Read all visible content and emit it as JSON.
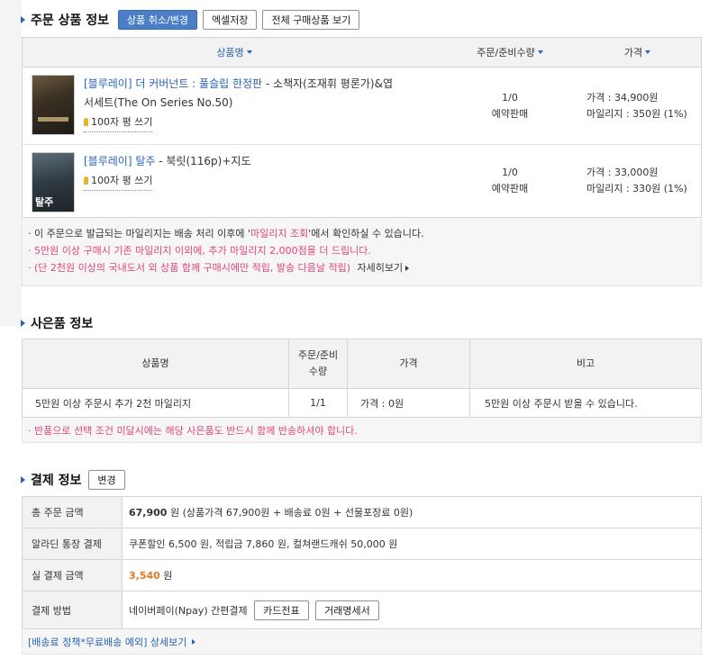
{
  "order": {
    "title": "주문 상품 정보",
    "buttons": {
      "cancel": "상품 취소/변경",
      "excel": "엑셀저장",
      "all": "전체 구매상품 보기"
    },
    "headers": {
      "name": "상품명",
      "qty": "주문/준비수량",
      "price": "가격"
    },
    "items": [
      {
        "link": "[블루레이] 더 커버넌트 : 풀슬립 한정판",
        "rest1": " - 소책자(조재휘 평론가)&엽",
        "rest2": "서세트(The On Series No.50)",
        "review": "100자 평 쓰기",
        "qty": "1/0",
        "status": "예약판매",
        "price": "가격 : 34,900원",
        "mileage": "마일리지 : 350원 (1%)",
        "cover_text": ""
      },
      {
        "link": "[블루레이] 탈주",
        "rest1": " - 북릿(116p)+지도",
        "rest2": "",
        "review": "100자 평 쓰기",
        "qty": "1/0",
        "status": "예약판매",
        "price": "가격 : 33,000원",
        "mileage": "마일리지 : 330원 (1%)",
        "cover_text": "탈주"
      }
    ],
    "notes": {
      "line1_a": "· 이 주문으로 발급되는 마일리지는 배송 처리 이후에 '",
      "line1_link": "마일리지 조회",
      "line1_b": "'에서 확인하실 수 있습니다.",
      "line2": "· 5만원 이상 구매시 기존 마일리지 이외에, 추가 마일리지 2,000점을 더 드립니다.",
      "line3": "· (단 2천원 이상의 국내도서 외 상품 함께 구매시에만 적립, 발송 다음날 적립)",
      "line3_more": "자세히보기"
    }
  },
  "gift": {
    "title": "사은품 정보",
    "headers": {
      "name": "상품명",
      "qty1": "주문/준비",
      "qty2": "수량",
      "price": "가격",
      "note": "비고"
    },
    "row": {
      "name": "5만원 이상 주문시 추가 2천 마일리지",
      "qty": "1/1",
      "price": "가격 : 0원",
      "note": "5만원 이상 주문시 받을 수 있습니다."
    },
    "notice": "· 반품으로 선택 조건 미달시에는 해당 사은품도 반드시 함께 반송하셔야 합니다."
  },
  "payment": {
    "title": "결제 정보",
    "change": "변경",
    "rows": {
      "total_label": "총 주문 금액",
      "total_amount": "67,900",
      "total_detail": " 원 (상품가격 67,900원 + 배송료 0원 + 선물포장료 0원)",
      "discount_label": "알라딘 통장 결제",
      "discount_value": "쿠폰할인 6,500 원, 적립금 7,860 원, 컬쳐랜드캐쉬 50,000 원",
      "actual_label": "실 결제 금액",
      "actual_amount": "3,540",
      "actual_unit": " 원",
      "method_label": "결제 방법",
      "method_value": "네이버페이(Npay) 간편결제",
      "card_btn": "카드전표",
      "receipt_btn": "거래명세서"
    },
    "policy": "[배송료 정책*무료배송 예외] 상세보기"
  }
}
